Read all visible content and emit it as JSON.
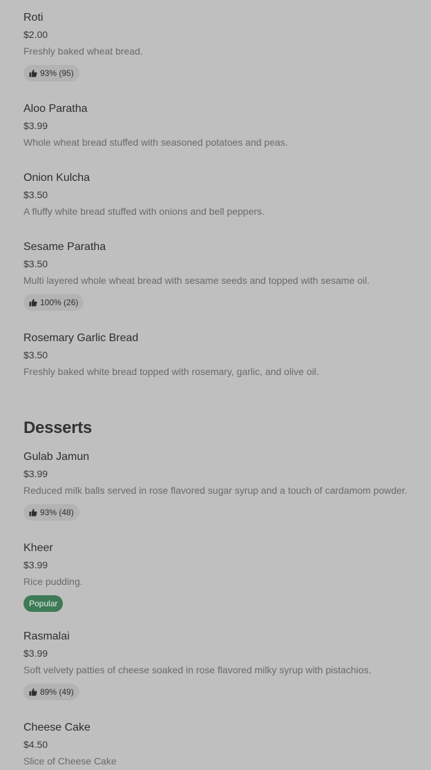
{
  "colors": {
    "background": "#bfbfbf",
    "rating_badge_bg": "#b3b3b3",
    "popular_badge_bg": "#3d7a55"
  },
  "breads": [
    {
      "name": "Roti",
      "price": "$2.00",
      "description": "Freshly baked wheat bread.",
      "rating": "93% (95)"
    },
    {
      "name": "Aloo Paratha",
      "price": "$3.99",
      "description": "Whole wheat bread stuffed with seasoned potatoes and peas."
    },
    {
      "name": "Onion Kulcha",
      "price": "$3.50",
      "description": "A fluffy white bread stuffed with onions and bell peppers."
    },
    {
      "name": "Sesame Paratha",
      "price": "$3.50",
      "description": "Multi layered whole wheat bread with sesame seeds and topped with sesame oil.",
      "rating": "100% (26)"
    },
    {
      "name": "Rosemary Garlic Bread",
      "price": "$3.50",
      "description": "Freshly baked white bread topped with rosemary, garlic, and olive oil."
    }
  ],
  "desserts_section": {
    "title": "Desserts"
  },
  "desserts": [
    {
      "name": "Gulab Jamun",
      "price": "$3.99",
      "description": "Reduced milk balls served in rose flavored sugar syrup and a touch of cardamom powder.",
      "rating": "93% (48)"
    },
    {
      "name": "Kheer",
      "price": "$3.99",
      "description": "Rice pudding.",
      "tag": "Popular"
    },
    {
      "name": "Rasmalai",
      "price": "$3.99",
      "description": "Soft velvety patties of cheese soaked in rose flavored milky syrup with pistachios.",
      "rating": "89% (49)"
    },
    {
      "name": "Cheese Cake",
      "price": "$4.50",
      "description": "Slice of Cheese Cake"
    }
  ],
  "icons": {
    "rating": "thumbs-up-icon"
  }
}
